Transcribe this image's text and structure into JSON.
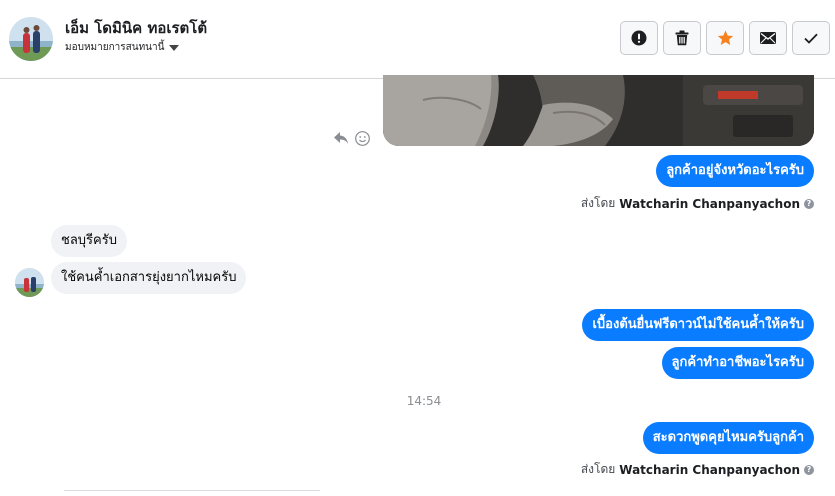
{
  "header": {
    "contact_name": "เอ็ม โดมินิค ทอเรตโต้",
    "assign_label": "มอบหมายการสนทนานี้"
  },
  "header_actions": [
    {
      "name": "mark-spam-button",
      "icon": "exclamation-icon",
      "color": "#1c1e21"
    },
    {
      "name": "delete-button",
      "icon": "trash-icon",
      "color": "#1c1e21"
    },
    {
      "name": "star-button",
      "icon": "star-icon",
      "color": "#f5821f"
    },
    {
      "name": "mark-unread-button",
      "icon": "envelope-icon",
      "color": "#1c1e21"
    },
    {
      "name": "mark-done-button",
      "icon": "check-icon",
      "color": "#1c1e21"
    }
  ],
  "messages": {
    "out_1": "ลูกค้าอยู่จังหวัดอะไรครับ",
    "sent_by_1": {
      "prefix": "ส่งโดย",
      "agent": "Watcharin Chanpanyachon"
    },
    "in_1": "ชลบุรีครับ",
    "in_2": "ใช้คนค้ำเอกสารยุ่งยากไหมครับ",
    "out_2": "เบื้องต้นยื่นฟรีดาวน์ไม่ใช้คนค้ำให้ครับ",
    "out_3": "ลูกค้าทำอาชีพอะไรครับ",
    "timestamp": "14:54",
    "out_4": "สะดวกพูดคุยไหมครับลูกค้า",
    "sent_by_2": {
      "prefix": "ส่งโดย",
      "agent": "Watcharin Chanpanyachon"
    }
  },
  "colors": {
    "outgoing_bubble": "#0a7cff",
    "incoming_bubble": "#f0f2f5",
    "star": "#f5821f"
  }
}
